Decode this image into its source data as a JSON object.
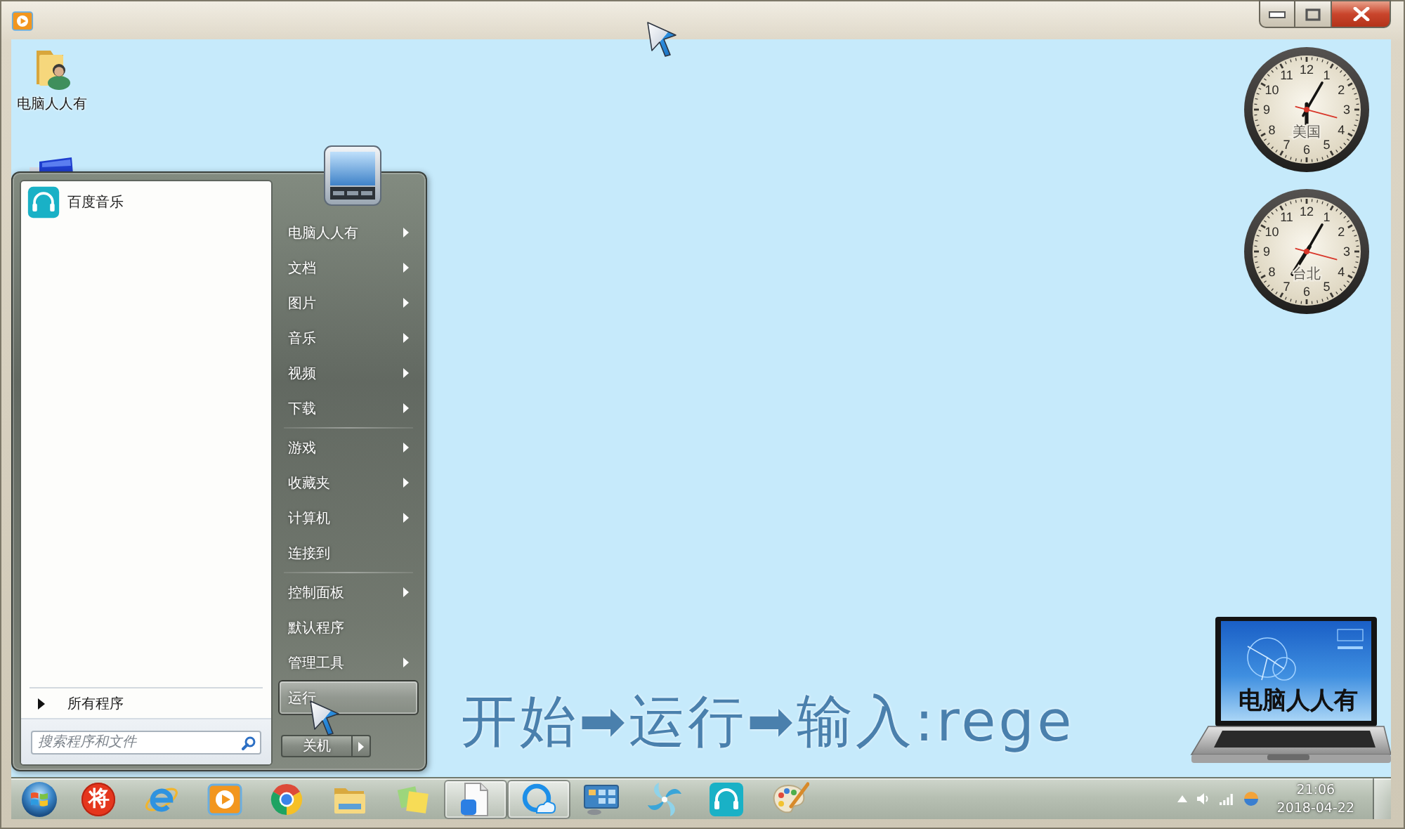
{
  "desktop_icons": [
    {
      "kind": "user-folder",
      "label": "电脑人人有"
    },
    {
      "kind": "computer"
    }
  ],
  "start_menu": {
    "programs": [
      {
        "label": "百度音乐"
      }
    ],
    "all_programs": "所有程序",
    "search": {
      "placeholder": "搜索程序和文件"
    },
    "place_groups": [
      {
        "items": [
          {
            "label": "电脑人人有",
            "submenu": true,
            "selected": false
          },
          {
            "label": "文档",
            "submenu": true,
            "selected": false
          },
          {
            "label": "图片",
            "submenu": true,
            "selected": false
          },
          {
            "label": "音乐",
            "submenu": true,
            "selected": false
          },
          {
            "label": "视频",
            "submenu": true,
            "selected": false
          },
          {
            "label": "下载",
            "submenu": true,
            "selected": false
          }
        ]
      },
      {
        "items": [
          {
            "label": "游戏",
            "submenu": true,
            "selected": false
          },
          {
            "label": "收藏夹",
            "submenu": true,
            "selected": false
          },
          {
            "label": "计算机",
            "submenu": true,
            "selected": false
          },
          {
            "label": "连接到",
            "submenu": false,
            "selected": false
          }
        ]
      },
      {
        "items": [
          {
            "label": "控制面板",
            "submenu": true,
            "selected": false
          },
          {
            "label": "默认程序",
            "submenu": false,
            "selected": false
          },
          {
            "label": "管理工具",
            "submenu": true,
            "selected": false
          },
          {
            "label": "运行",
            "submenu": false,
            "selected": true
          }
        ]
      }
    ],
    "shutdown": "关机"
  },
  "clocks": [
    {
      "city": "美国",
      "numerals": [
        "12",
        "11",
        "1",
        "10",
        "2",
        "9",
        "3",
        "8",
        "4",
        "7",
        "5",
        "6"
      ]
    },
    {
      "city": "台北",
      "numerals": [
        "12",
        "11",
        "1",
        "10",
        "2",
        "9",
        "3",
        "8",
        "4",
        "7",
        "5",
        "6"
      ]
    }
  ],
  "caption": "开始➡运行➡输入:rege",
  "logo": {
    "text": "电脑人人有"
  },
  "taskbar": {
    "items": [
      {
        "kind": "start",
        "active": false
      },
      {
        "kind": "glyph",
        "label": "将",
        "active": false
      },
      {
        "kind": "browser-e",
        "active": false
      },
      {
        "kind": "player",
        "active": false
      },
      {
        "kind": "browser-round",
        "active": false
      },
      {
        "kind": "folder",
        "active": false
      },
      {
        "kind": "notes",
        "active": false
      },
      {
        "kind": "document",
        "active": true
      },
      {
        "kind": "cloud",
        "active": true
      },
      {
        "kind": "monitor",
        "active": false
      },
      {
        "kind": "pinwheel",
        "active": false
      },
      {
        "kind": "headphones",
        "active": false
      },
      {
        "kind": "palette",
        "active": false
      }
    ],
    "tray": {
      "time": "21:06",
      "date": "2018-04-22"
    }
  }
}
